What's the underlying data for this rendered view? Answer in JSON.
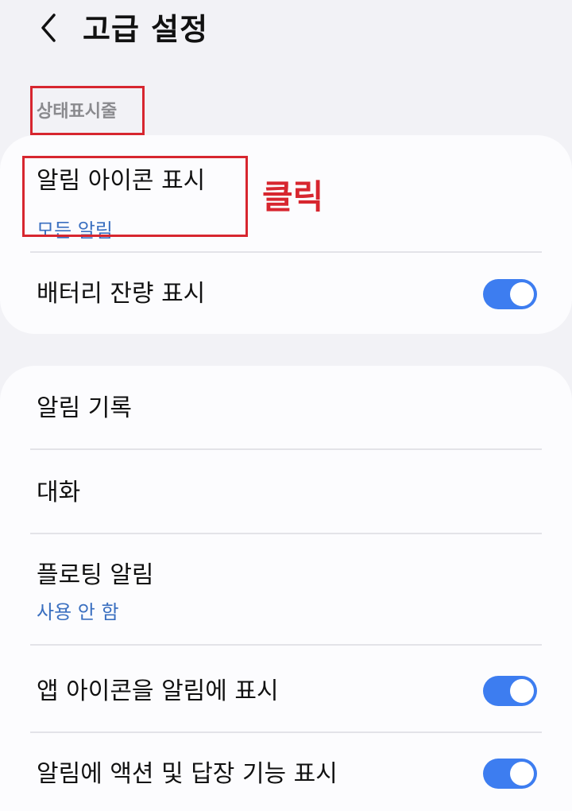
{
  "header": {
    "back_icon": "chevron-left-icon",
    "title": "고급 설정"
  },
  "section": {
    "label": "상태표시줄"
  },
  "annotation": {
    "text": "클릭",
    "color": "#d7262f"
  },
  "status_bar_card": {
    "items": [
      {
        "title": "알림 아이콘 표시",
        "subtitle": "모든 알림"
      },
      {
        "title": "배터리 잔량 표시",
        "toggle": true
      }
    ]
  },
  "notification_card": {
    "items": [
      {
        "title": "알림 기록"
      },
      {
        "title": "대화"
      },
      {
        "title": "플로팅 알림",
        "subtitle": "사용 안 함"
      },
      {
        "title": "앱 아이콘을 알림에 표시",
        "toggle": true
      },
      {
        "title": "알림에 액션 및 답장 기능 표시",
        "toggle": true
      }
    ]
  },
  "colors": {
    "background": "#f2f2f6",
    "card": "#fcfcfe",
    "accent": "#3d7df0",
    "subtitle": "#3a6fc0",
    "section_label": "#8a8a8e"
  }
}
